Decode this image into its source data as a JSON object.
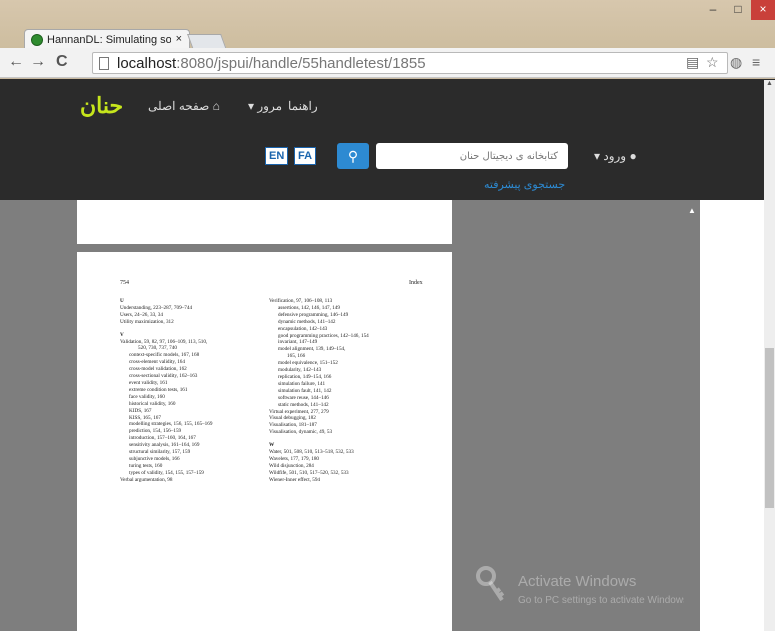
{
  "browser": {
    "tab_title": "HannanDL: Simulating so",
    "tab_close": "×",
    "url_host": "localhost",
    "url_rest": ":8080/jspui/handle/55handletest/1855",
    "win_min": "–",
    "win_max": "□",
    "win_close": "×",
    "back": "←",
    "forward": "→",
    "reload": "C"
  },
  "site": {
    "logo": "حنان",
    "nav_home": "صفحه اصلی",
    "nav_browse": "مرور",
    "nav_help": "راهنما",
    "lang_en": "EN",
    "lang_fa": "FA",
    "search_placeholder": "کتابخانه ی دیجیتال حنان",
    "login": "ورود",
    "advanced_search": "جستجوی پیشرفته"
  },
  "document": {
    "page_number": "754",
    "header": "Index",
    "left_column": [
      {
        "t": "letter",
        "v": "U"
      },
      {
        "t": "e",
        "v": "Understanding, 223–287, 709–744"
      },
      {
        "t": "e",
        "v": "Users, 24–26, 33, 34"
      },
      {
        "t": "e",
        "v": "Utility maximization, 312"
      },
      {
        "t": "letter",
        "v": "V"
      },
      {
        "t": "e",
        "v": "Validation, 59, 82, 97, 106–109, 113, 510,"
      },
      {
        "t": "sub2",
        "v": "520, 730, 737, 740"
      },
      {
        "t": "sub",
        "v": "context-specific models, 167, 168"
      },
      {
        "t": "sub",
        "v": "cross-element validity, 164"
      },
      {
        "t": "sub",
        "v": "cross-model validation, 162"
      },
      {
        "t": "sub",
        "v": "cross-sectional validity, 162–163"
      },
      {
        "t": "sub",
        "v": "event validity, 161"
      },
      {
        "t": "sub",
        "v": "extreme condition tests, 161"
      },
      {
        "t": "sub",
        "v": "face validity, 160"
      },
      {
        "t": "sub",
        "v": "historical validity, 160"
      },
      {
        "t": "sub",
        "v": "KIDS, 167"
      },
      {
        "t": "sub",
        "v": "KISS, 165, 167"
      },
      {
        "t": "sub",
        "v": "modelling strategies, 156, 155, 165–169"
      },
      {
        "t": "sub",
        "v": "prediction, 154, 156–159"
      },
      {
        "t": "sub",
        "v": "introduction, 157–160, 164, 167"
      },
      {
        "t": "sub",
        "v": "sensitivity analysis, 161–164, 169"
      },
      {
        "t": "sub",
        "v": "structural similarity, 157, 159"
      },
      {
        "t": "sub",
        "v": "subjunctive models, 166"
      },
      {
        "t": "sub",
        "v": "turing tests, 160"
      },
      {
        "t": "sub",
        "v": "types of validity, 154, 155, 157–159"
      },
      {
        "t": "e",
        "v": "Verbal argumentation, 98"
      }
    ],
    "right_column": [
      {
        "t": "e",
        "v": "Verification, 97, 106–108, 113"
      },
      {
        "t": "sub",
        "v": "assertions, 142, 146, 147, 149"
      },
      {
        "t": "sub",
        "v": "defensive programming, 146–149"
      },
      {
        "t": "sub",
        "v": "dynamic methods, 141–142"
      },
      {
        "t": "sub",
        "v": "encapsulation, 142–143"
      },
      {
        "t": "sub",
        "v": "good programming practices, 142–146, 154"
      },
      {
        "t": "sub",
        "v": "invariant, 147–149"
      },
      {
        "t": "sub",
        "v": "model alignment, 139, 149–154,"
      },
      {
        "t": "sub2",
        "v": "165, 166"
      },
      {
        "t": "sub",
        "v": "model equivalence, 151–152"
      },
      {
        "t": "sub",
        "v": "modularity, 142–143"
      },
      {
        "t": "sub",
        "v": "replication, 149–154, 166"
      },
      {
        "t": "sub",
        "v": "simulation failure, 141"
      },
      {
        "t": "sub",
        "v": "simulation fault, 141, 142"
      },
      {
        "t": "sub",
        "v": "software reuse, 144–146"
      },
      {
        "t": "sub",
        "v": "static methods, 141–142"
      },
      {
        "t": "e",
        "v": "Virtual experiment, 277, 279"
      },
      {
        "t": "e",
        "v": "Visual debugging, 182"
      },
      {
        "t": "e",
        "v": "Visualisation, 181–187"
      },
      {
        "t": "e",
        "v": "Visualisation, dynamic, 49, 53"
      },
      {
        "t": "letter",
        "v": "W"
      },
      {
        "t": "e",
        "v": "Water, 501, 508, 510, 513–518, 532, 533"
      },
      {
        "t": "e",
        "v": "Wavelets, 177, 179, 180"
      },
      {
        "t": "e",
        "v": "Wild disjunction, 284"
      },
      {
        "t": "e",
        "v": "Wildfife, 501, 510, 517–520, 532, 533"
      },
      {
        "t": "e",
        "v": "Wiener-Inner effect, 594"
      }
    ]
  },
  "os": {
    "activate_title": "Activate Windows",
    "activate_sub": "Go to PC settings to activate Windows."
  }
}
